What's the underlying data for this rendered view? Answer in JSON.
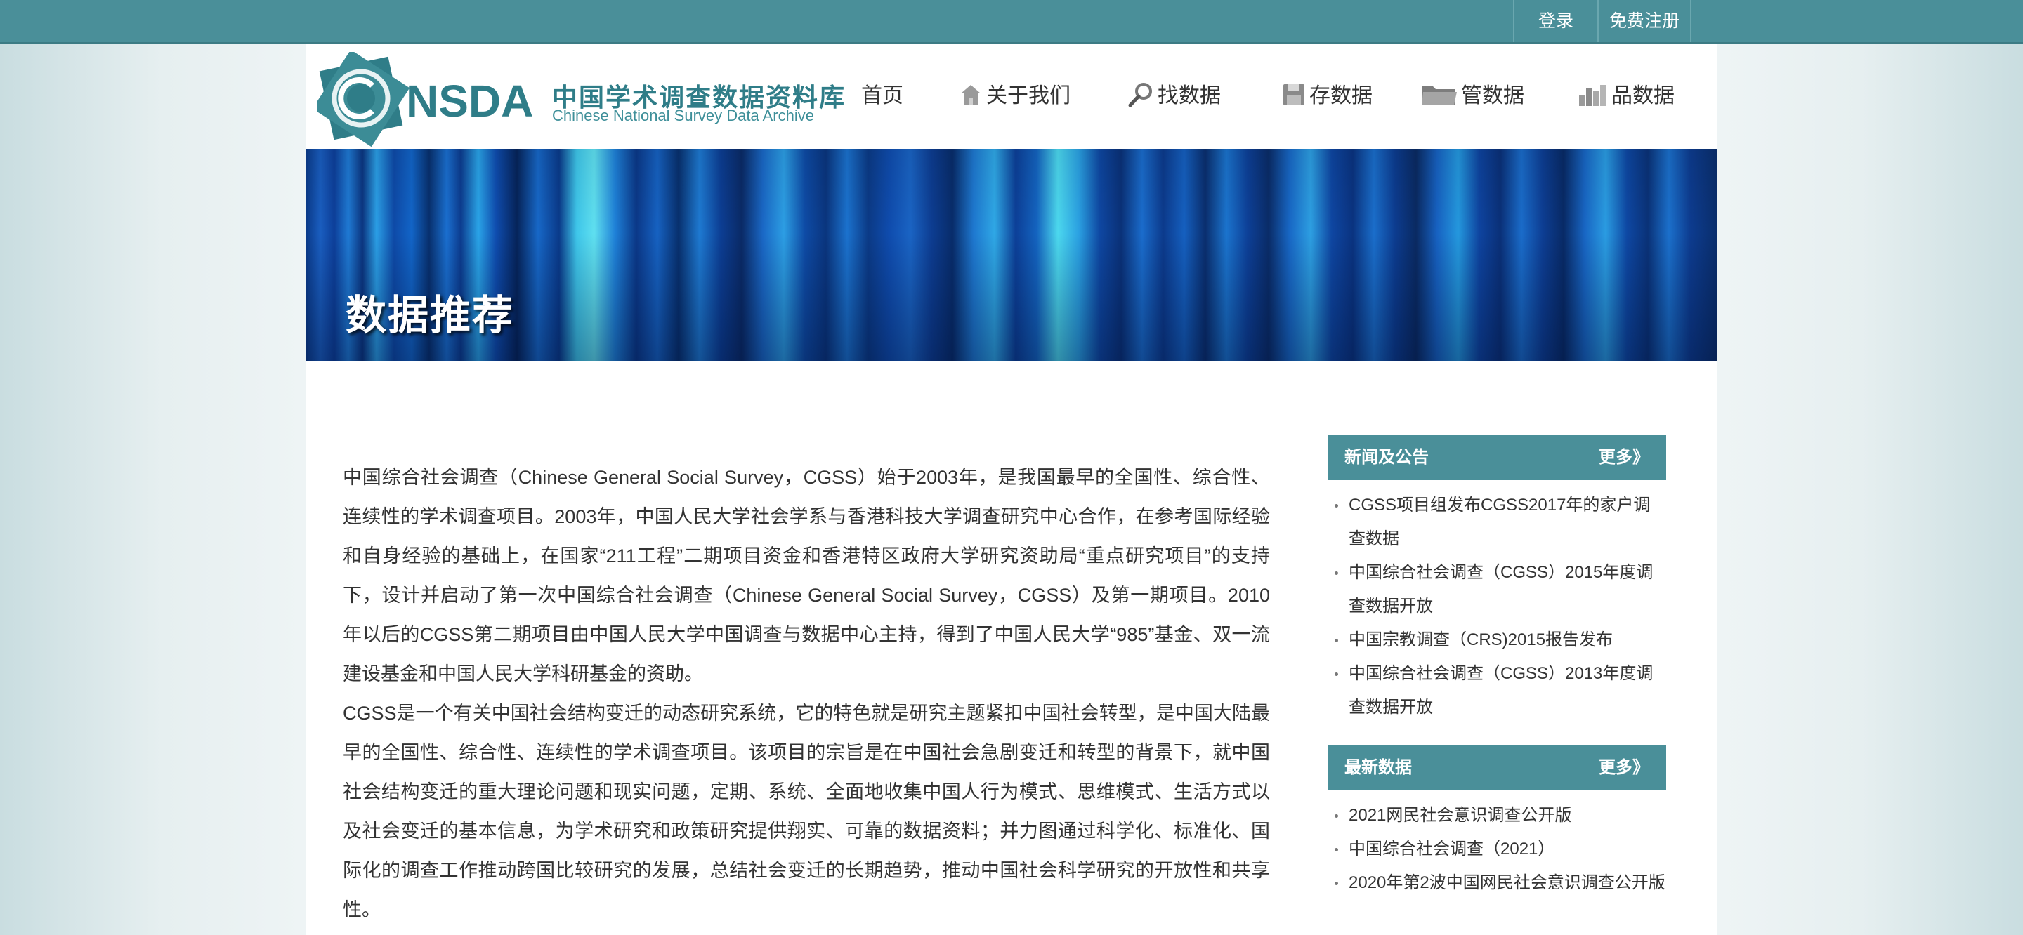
{
  "topbar": {
    "login": "登录",
    "register": "免费注册"
  },
  "logo": {
    "mark": "NSDA",
    "cn": "中国学术调查数据资料库",
    "en": "Chinese National Survey Data Archive"
  },
  "nav": {
    "home": "首页",
    "about": "关于我们",
    "find": "找数据",
    "store": "存数据",
    "manage": "管数据",
    "evaluate": "品数据"
  },
  "banner": {
    "title": "数据推荐"
  },
  "article": {
    "paragraphs": [
      "中国综合社会调查（Chinese General Social Survey，CGSS）始于2003年，是我国最早的全国性、综合性、连续性的学术调查项目。2003年，中国人民大学社会学系与香港科技大学调查研究中心合作，在参考国际经验和自身经验的基础上，在国家“211工程”二期项目资金和香港特区政府大学研究资助局“重点研究项目”的支持下，设计并启动了第一次中国综合社会调查（Chinese General Social Survey，CGSS）及第一期项目。2010年以后的CGSS第二期项目由中国人民大学中国调查与数据中心主持，得到了中国人民大学“985”基金、双一流建设基金和中国人民大学科研基金的资助。",
      "CGSS是一个有关中国社会结构变迁的动态研究系统，它的特色就是研究主题紧扣中国社会转型，是中国大陆最早的全国性、综合性、连续性的学术调查项目。该项目的宗旨是在中国社会急剧变迁和转型的背景下，就中国社会结构变迁的重大理论问题和现实问题，定期、系统、全面地收集中国人行为模式、思维模式、生活方式以及社会变迁的基本信息，为学术研究和政策研究提供翔实、可靠的数据资料；并力图通过科学化、标准化、国际化的调查工作推动跨国比较研究的发展，总结社会变迁的长期趋势，推动中国社会科学研究的开放性和共享性。"
    ]
  },
  "news": {
    "title": "新闻及公告",
    "more": "更多》",
    "items": [
      "CGSS项目组发布CGSS2017年的家户调查数据",
      "中国综合社会调查（CGSS）2015年度调查数据开放",
      "中国宗教调查（CRS)2015报告发布",
      "中国综合社会调查（CGSS）2013年度调查数据开放"
    ]
  },
  "latest": {
    "title": "最新数据",
    "more": "更多》",
    "items": [
      "2021网民社会意识调查公开版",
      "中国综合社会调查（2021）",
      "2020年第2波中国网民社会意识调查公开版"
    ]
  },
  "colors": {
    "accent": "#4a8f99",
    "logo": "#2f7d88"
  }
}
